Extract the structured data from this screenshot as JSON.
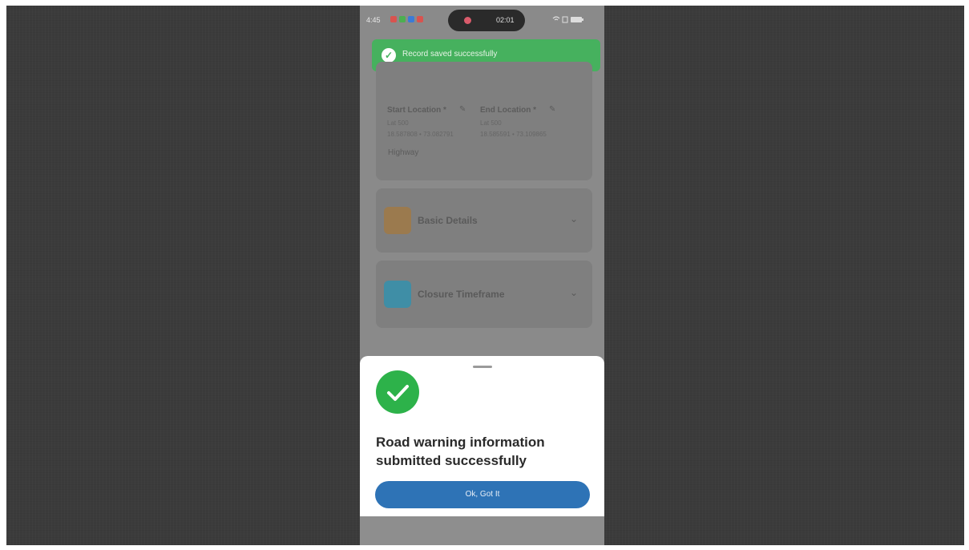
{
  "status_bar": {
    "time": "4:45",
    "recording_time": "02:01",
    "notification_colors": [
      "#d9534f",
      "#4caf50",
      "#3b7bd6",
      "#d9534f"
    ],
    "system_icons": "wifi-icon sim-icon battery-icon"
  },
  "toast": {
    "message": "Record saved successfully",
    "color": "#46b15e"
  },
  "route_card": {
    "start_label": "Start Location *",
    "start_line1": "Lat 500",
    "start_line2": "18.587808 • 73.082791",
    "end_label": "End Location *",
    "end_line1": "Lat 500",
    "end_line2": "18.585591 • 73.109865",
    "road_type": "Highway"
  },
  "sections": [
    {
      "title": "Basic Details",
      "icon": "document-icon",
      "icon_color": "#9b7a4e"
    },
    {
      "title": "Closure Timeframe",
      "icon": "clock-icon",
      "icon_color": "#3f8ea6"
    }
  ],
  "dialog": {
    "message": "Road warning information submitted successfully",
    "button_label": "Ok, Got It",
    "icon_color": "#2db24a",
    "button_color": "#2e73b6"
  }
}
